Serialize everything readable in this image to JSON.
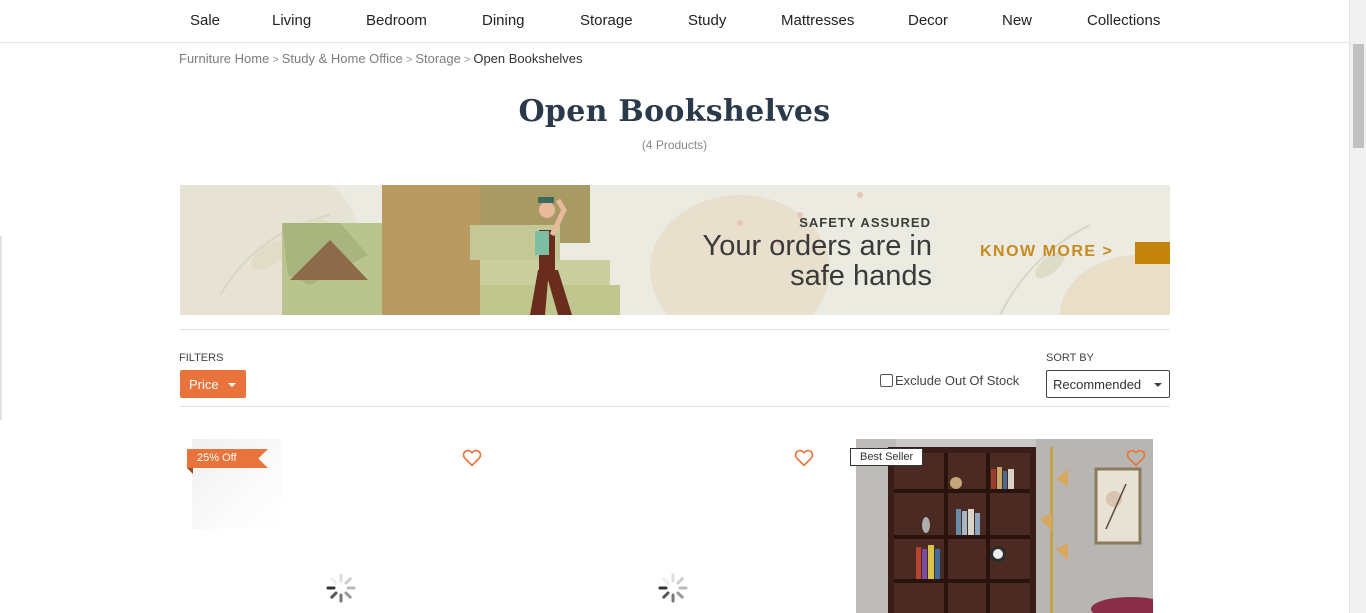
{
  "nav": {
    "items": [
      "Sale",
      "Living",
      "Bedroom",
      "Dining",
      "Storage",
      "Study",
      "Mattresses",
      "Decor",
      "New",
      "Collections"
    ]
  },
  "breadcrumb": {
    "items": [
      "Furniture Home",
      "Study & Home Office",
      "Storage"
    ],
    "separator": ">",
    "current": "Open Bookshelves"
  },
  "page": {
    "title": "Open Bookshelves",
    "count": "(4 Products)"
  },
  "banner": {
    "eyebrow": "SAFETY ASSURED",
    "headline_line1": "Your orders are in",
    "headline_line2": "safe hands",
    "cta": "KNOW MORE >",
    "colors": {
      "background": "#ecebe2",
      "cta": "#c78a1e",
      "tab": "#c4830b"
    }
  },
  "filters": {
    "label": "FILTERS",
    "price_label": "Price",
    "exclude_label": "Exclude Out Of Stock",
    "exclude_checked": false
  },
  "sort": {
    "label": "SORT BY",
    "selected": "Recommended"
  },
  "products": [
    {
      "badge": "25% Off",
      "badge_type": "discount",
      "image_state": "loading",
      "wishlist_icon": "heart-outline-icon"
    },
    {
      "badge": "",
      "badge_type": "none",
      "image_state": "loading",
      "wishlist_icon": "heart-outline-icon"
    },
    {
      "badge": "Best Seller",
      "badge_type": "bestseller",
      "image_state": "loaded",
      "wishlist_icon": "heart-outline-icon"
    }
  ],
  "colors": {
    "accent": "#e8743b",
    "title": "#2b3a4a"
  }
}
